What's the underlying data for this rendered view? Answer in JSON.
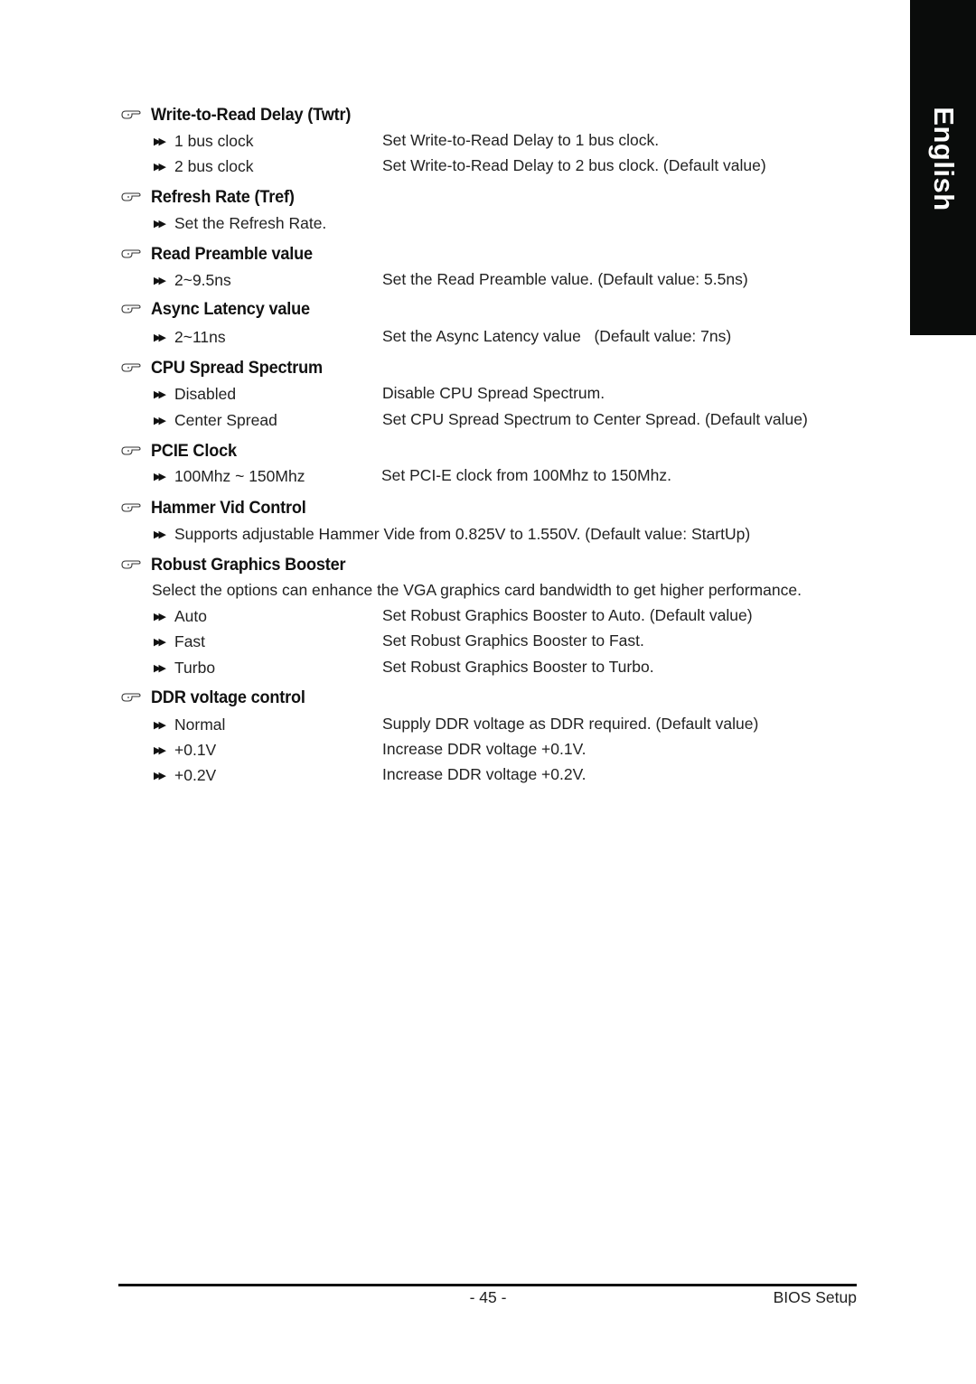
{
  "side_tab": {
    "label": "English"
  },
  "sections": [
    {
      "title": "Write-to-Read Delay (Twtr)",
      "options": [
        {
          "option": "1 bus clock",
          "description": "Set Write-to-Read Delay to 1 bus clock."
        },
        {
          "option": "2 bus clock",
          "description": "Set Write-to-Read Delay to 2 bus clock. (Default value)"
        }
      ]
    },
    {
      "title": "Refresh Rate (Tref)",
      "options": [
        {
          "option": "Set the Refresh Rate.",
          "description": ""
        }
      ]
    },
    {
      "title": "Read Preamble value",
      "options": [
        {
          "option": "2~9.5ns",
          "description": "Set the Read Preamble value. (Default value: 5.5ns)"
        }
      ]
    },
    {
      "title": "Async Latency value",
      "options": [
        {
          "option": "2~11ns",
          "description": "Set the Async Latency value   (Default value: 7ns)"
        }
      ]
    },
    {
      "title": "CPU Spread Spectrum",
      "options": [
        {
          "option": "Disabled",
          "description": "Disable CPU Spread Spectrum."
        },
        {
          "option": "Center Spread",
          "description": "Set CPU Spread Spectrum to Center Spread. (Default value)"
        }
      ]
    },
    {
      "title": "PCIE Clock",
      "options": [
        {
          "option": "100Mhz ~ 150Mhz",
          "description": "Set PCI-E clock from 100Mhz to 150Mhz."
        }
      ]
    },
    {
      "title": "Hammer Vid Control",
      "options": [
        {
          "option": "Supports adjustable Hammer Vide from 0.825V to 1.550V. (Default value: StartUp)",
          "description": ""
        }
      ]
    },
    {
      "title": "Robust Graphics Booster",
      "intro": "Select the options can enhance the VGA graphics card bandwidth to get higher performance.",
      "options": [
        {
          "option": "Auto",
          "description": "Set Robust Graphics Booster to Auto. (Default value)"
        },
        {
          "option": "Fast",
          "description": "Set Robust Graphics Booster to Fast."
        },
        {
          "option": "Turbo",
          "description": "Set Robust Graphics Booster to Turbo."
        }
      ]
    },
    {
      "title": "DDR voltage control",
      "options": [
        {
          "option": "Normal",
          "description": "Supply DDR voltage as DDR required. (Default value)"
        },
        {
          "option": "+0.1V",
          "description": "Increase DDR voltage +0.1V."
        },
        {
          "option": "+0.2V",
          "description": "Increase DDR voltage +0.2V."
        }
      ]
    }
  ],
  "icons": {
    "heading_bullet": "pointing-hand-icon",
    "option_bullet": "double-arrow-icon"
  },
  "footer": {
    "page_number": "- 45 -",
    "section_title": "BIOS Setup"
  }
}
